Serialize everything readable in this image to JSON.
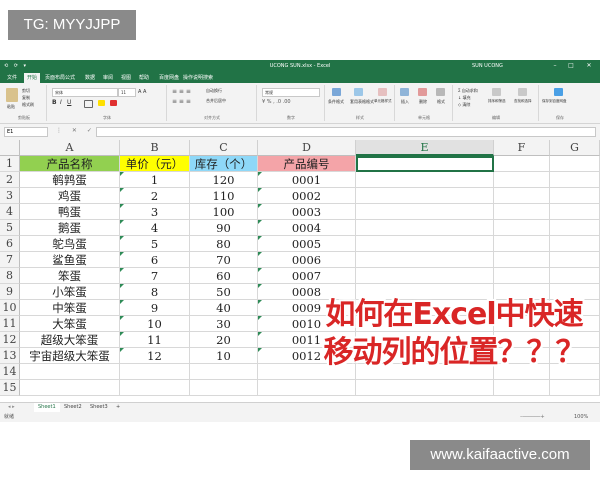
{
  "watermark_top": "TG: MYYJJPP",
  "watermark_bottom": "www.kaifaactive.com",
  "window": {
    "title": "UCONG SUN.xlsx  -  Excel",
    "user": "SUN UCONG",
    "qat": "⟲ ⟳ ▾"
  },
  "ribbon_tabs": [
    "文件",
    "开始",
    "页面布局",
    "公式",
    "数据",
    "审阅",
    "视图",
    "帮助",
    "百度网盘",
    "操作说明搜索"
  ],
  "ribbon_tab_active": 1,
  "ribbon": {
    "font_name": "宋体",
    "font_size": "11",
    "number_format": "常规",
    "wrap_text": "自动换行",
    "merge_center": "合并后居中",
    "cond_format": "条件格式",
    "table_format": "套用表格格式",
    "cell_styles": "单元格样式",
    "insert": "插入",
    "delete": "删除",
    "format": "格式",
    "autosum": "自动求和",
    "fill": "填充",
    "clear": "清除",
    "sort_filter": "排序和筛选",
    "find_select": "查找和选择",
    "save_baidu": "保存到百度网盘",
    "groups": [
      "剪贴板",
      "字体",
      "对齐方式",
      "数字",
      "样式",
      "单元格",
      "编辑",
      "保存"
    ],
    "paste": "粘贴",
    "cut": "剪切",
    "copy": "复制",
    "format_painter": "格式刷"
  },
  "formula_bar": {
    "name_box": "E1",
    "buttons": "⋮ ✕ ✓ fx",
    "content": ""
  },
  "columns": [
    "A",
    "B",
    "C",
    "D",
    "E",
    "F",
    "G"
  ],
  "selected_column": "E",
  "rows": [
    "1",
    "2",
    "3",
    "4",
    "5",
    "6",
    "7",
    "8",
    "9",
    "10",
    "11",
    "12",
    "13",
    "14",
    "15"
  ],
  "headers": {
    "a1": "产品名称",
    "b1": "单价（元）",
    "c1": "库存（个）",
    "d1": "产品编号"
  },
  "header_colors": {
    "a1": "#92d050",
    "b1": "#ffff00",
    "c1": "#8ed8f8",
    "d1": "#f4a4a8"
  },
  "table": [
    {
      "name": "鹌鹑蛋",
      "price": "1",
      "stock": "120",
      "code": "0001"
    },
    {
      "name": "鸡蛋",
      "price": "2",
      "stock": "110",
      "code": "0002"
    },
    {
      "name": "鸭蛋",
      "price": "3",
      "stock": "100",
      "code": "0003"
    },
    {
      "name": "鹅蛋",
      "price": "4",
      "stock": "90",
      "code": "0004"
    },
    {
      "name": "鸵鸟蛋",
      "price": "5",
      "stock": "80",
      "code": "0005"
    },
    {
      "name": "鲨鱼蛋",
      "price": "6",
      "stock": "70",
      "code": "0006"
    },
    {
      "name": "笨蛋",
      "price": "7",
      "stock": "60",
      "code": "0007"
    },
    {
      "name": "小笨蛋",
      "price": "8",
      "stock": "50",
      "code": "0008"
    },
    {
      "name": "中笨蛋",
      "price": "9",
      "stock": "40",
      "code": "0009"
    },
    {
      "name": "大笨蛋",
      "price": "10",
      "stock": "30",
      "code": "0010"
    },
    {
      "name": "超级大笨蛋",
      "price": "11",
      "stock": "20",
      "code": "0011"
    },
    {
      "name": "宇宙超级大笨蛋",
      "price": "12",
      "stock": "10",
      "code": "0012"
    }
  ],
  "sheet_tabs": [
    "Sheet1",
    "Sheet2",
    "Sheet3",
    "+"
  ],
  "active_sheet": "Sheet1",
  "status": "就绪",
  "zoom": "100%",
  "overlay": {
    "line1": "如何在Excel中快速",
    "line2": "移动列的位置？？？"
  }
}
